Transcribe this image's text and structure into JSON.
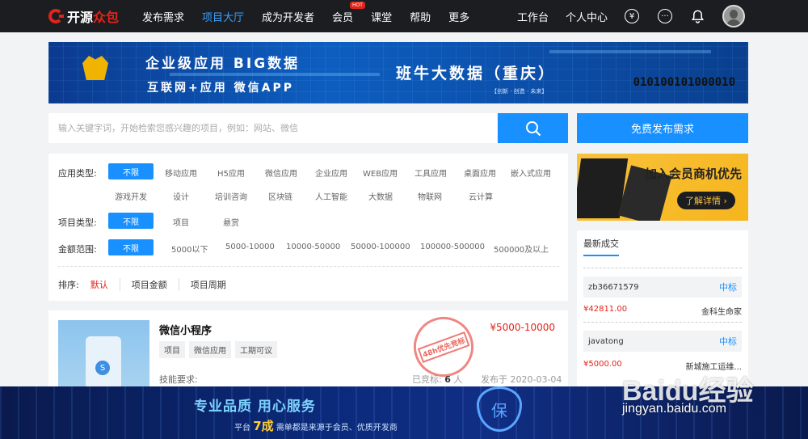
{
  "logo": {
    "text_a": "开源",
    "text_b": "众包"
  },
  "nav": [
    "发布需求",
    "项目大厅",
    "成为开发者",
    "会员",
    "课堂",
    "帮助",
    "更多"
  ],
  "nav_hot": "HOT",
  "right_nav": {
    "workbench": "工作台",
    "personal": "个人中心",
    "yuan_symbol": "¥",
    "chat_symbol": "···"
  },
  "banner": {
    "line1": "企业级应用 BIG数据",
    "line2": "互联网+应用 微信APP",
    "company": "班牛大数据（重庆）",
    "tagline": "【创新 · 创造 · 未来】",
    "binary": "010100101000010"
  },
  "search": {
    "placeholder": "输入关键字词，开始检索您感兴趣的项目，例如：网站、微信"
  },
  "publish_button": "免费发布需求",
  "filters": {
    "app_type_label": "应用类型:",
    "app_types_row1": [
      "不限",
      "移动应用",
      "H5应用",
      "微信应用",
      "企业应用",
      "WEB应用",
      "工具应用",
      "桌面应用",
      "嵌入式应用"
    ],
    "app_types_row2": [
      "游戏开发",
      "设计",
      "培训咨询",
      "区块链",
      "人工智能",
      "大数据",
      "物联网",
      "云计算"
    ],
    "project_type_label": "项目类型:",
    "project_types": [
      "不限",
      "项目",
      "悬赏"
    ],
    "amount_label": "金额范围:",
    "amounts": [
      "不限",
      "5000以下",
      "5000-10000",
      "10000-50000",
      "50000-100000",
      "100000-500000",
      "500000及以上"
    ]
  },
  "sort": {
    "label": "排序:",
    "options": [
      "默认",
      "项目金额",
      "项目周期"
    ]
  },
  "project": {
    "title": "微信小程序",
    "tags": [
      "项目",
      "微信应用",
      "工期可议"
    ],
    "price": "¥5000-10000",
    "stamp": "48h优先竞标",
    "skill_label": "技能要求:",
    "bids_label": "已竞标:",
    "bids_count": "6",
    "bids_unit": "人",
    "date_label": "发布于",
    "date": "2020-03-04"
  },
  "member_ad": {
    "title": "加入会员商机优先",
    "button": "了解详情 ›"
  },
  "recent": {
    "title": "最新成交",
    "items": [
      {
        "name": "zb36671579",
        "status": "中标",
        "amount": "¥42811.00",
        "client": "金科生命家"
      },
      {
        "name": "javatong",
        "status": "中标",
        "amount": "¥5000.00",
        "client": "新城施工运维..."
      }
    ]
  },
  "bottom_banner": {
    "headline": "专业品质 用心服务",
    "sub_a": "平台",
    "sub_b": "7成",
    "sub_c": "需单都是来源于会员、优质开发商",
    "shield_char": "保"
  },
  "watermark": {
    "brand": "Baidu经验",
    "url": "jingyan.baidu.com"
  },
  "colors": {
    "accent": "#1890ff",
    "brand_red": "#e2231a",
    "topbar": "#1c1d21"
  }
}
